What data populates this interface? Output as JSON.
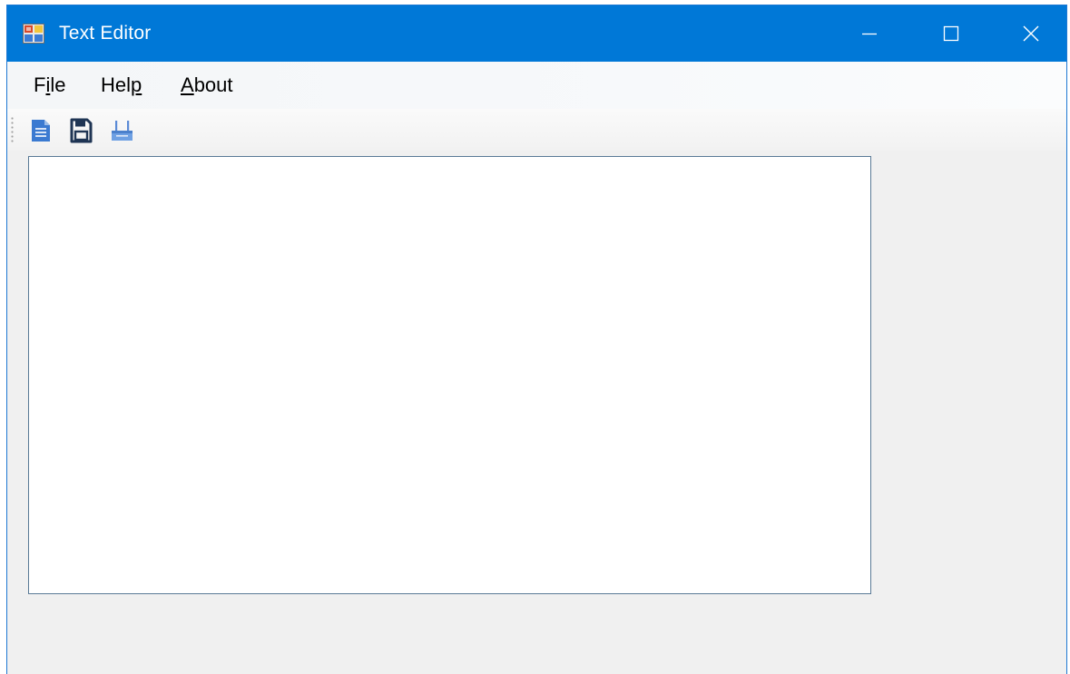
{
  "window": {
    "title": "Text Editor",
    "icon": "app-window-icon",
    "controls": {
      "minimize": "minimize-icon",
      "maximize": "maximize-icon",
      "close": "close-icon"
    },
    "accent_color": "#0078d7"
  },
  "menubar": {
    "items": [
      {
        "label": "File",
        "mnemonic": "i"
      },
      {
        "label": "Help",
        "mnemonic": "p"
      },
      {
        "label": "About",
        "mnemonic": "A"
      }
    ]
  },
  "toolbar": {
    "buttons": [
      {
        "name": "new",
        "icon": "document-icon"
      },
      {
        "name": "save",
        "icon": "save-icon"
      },
      {
        "name": "print",
        "icon": "print-icon"
      }
    ]
  },
  "editor": {
    "value": ""
  }
}
